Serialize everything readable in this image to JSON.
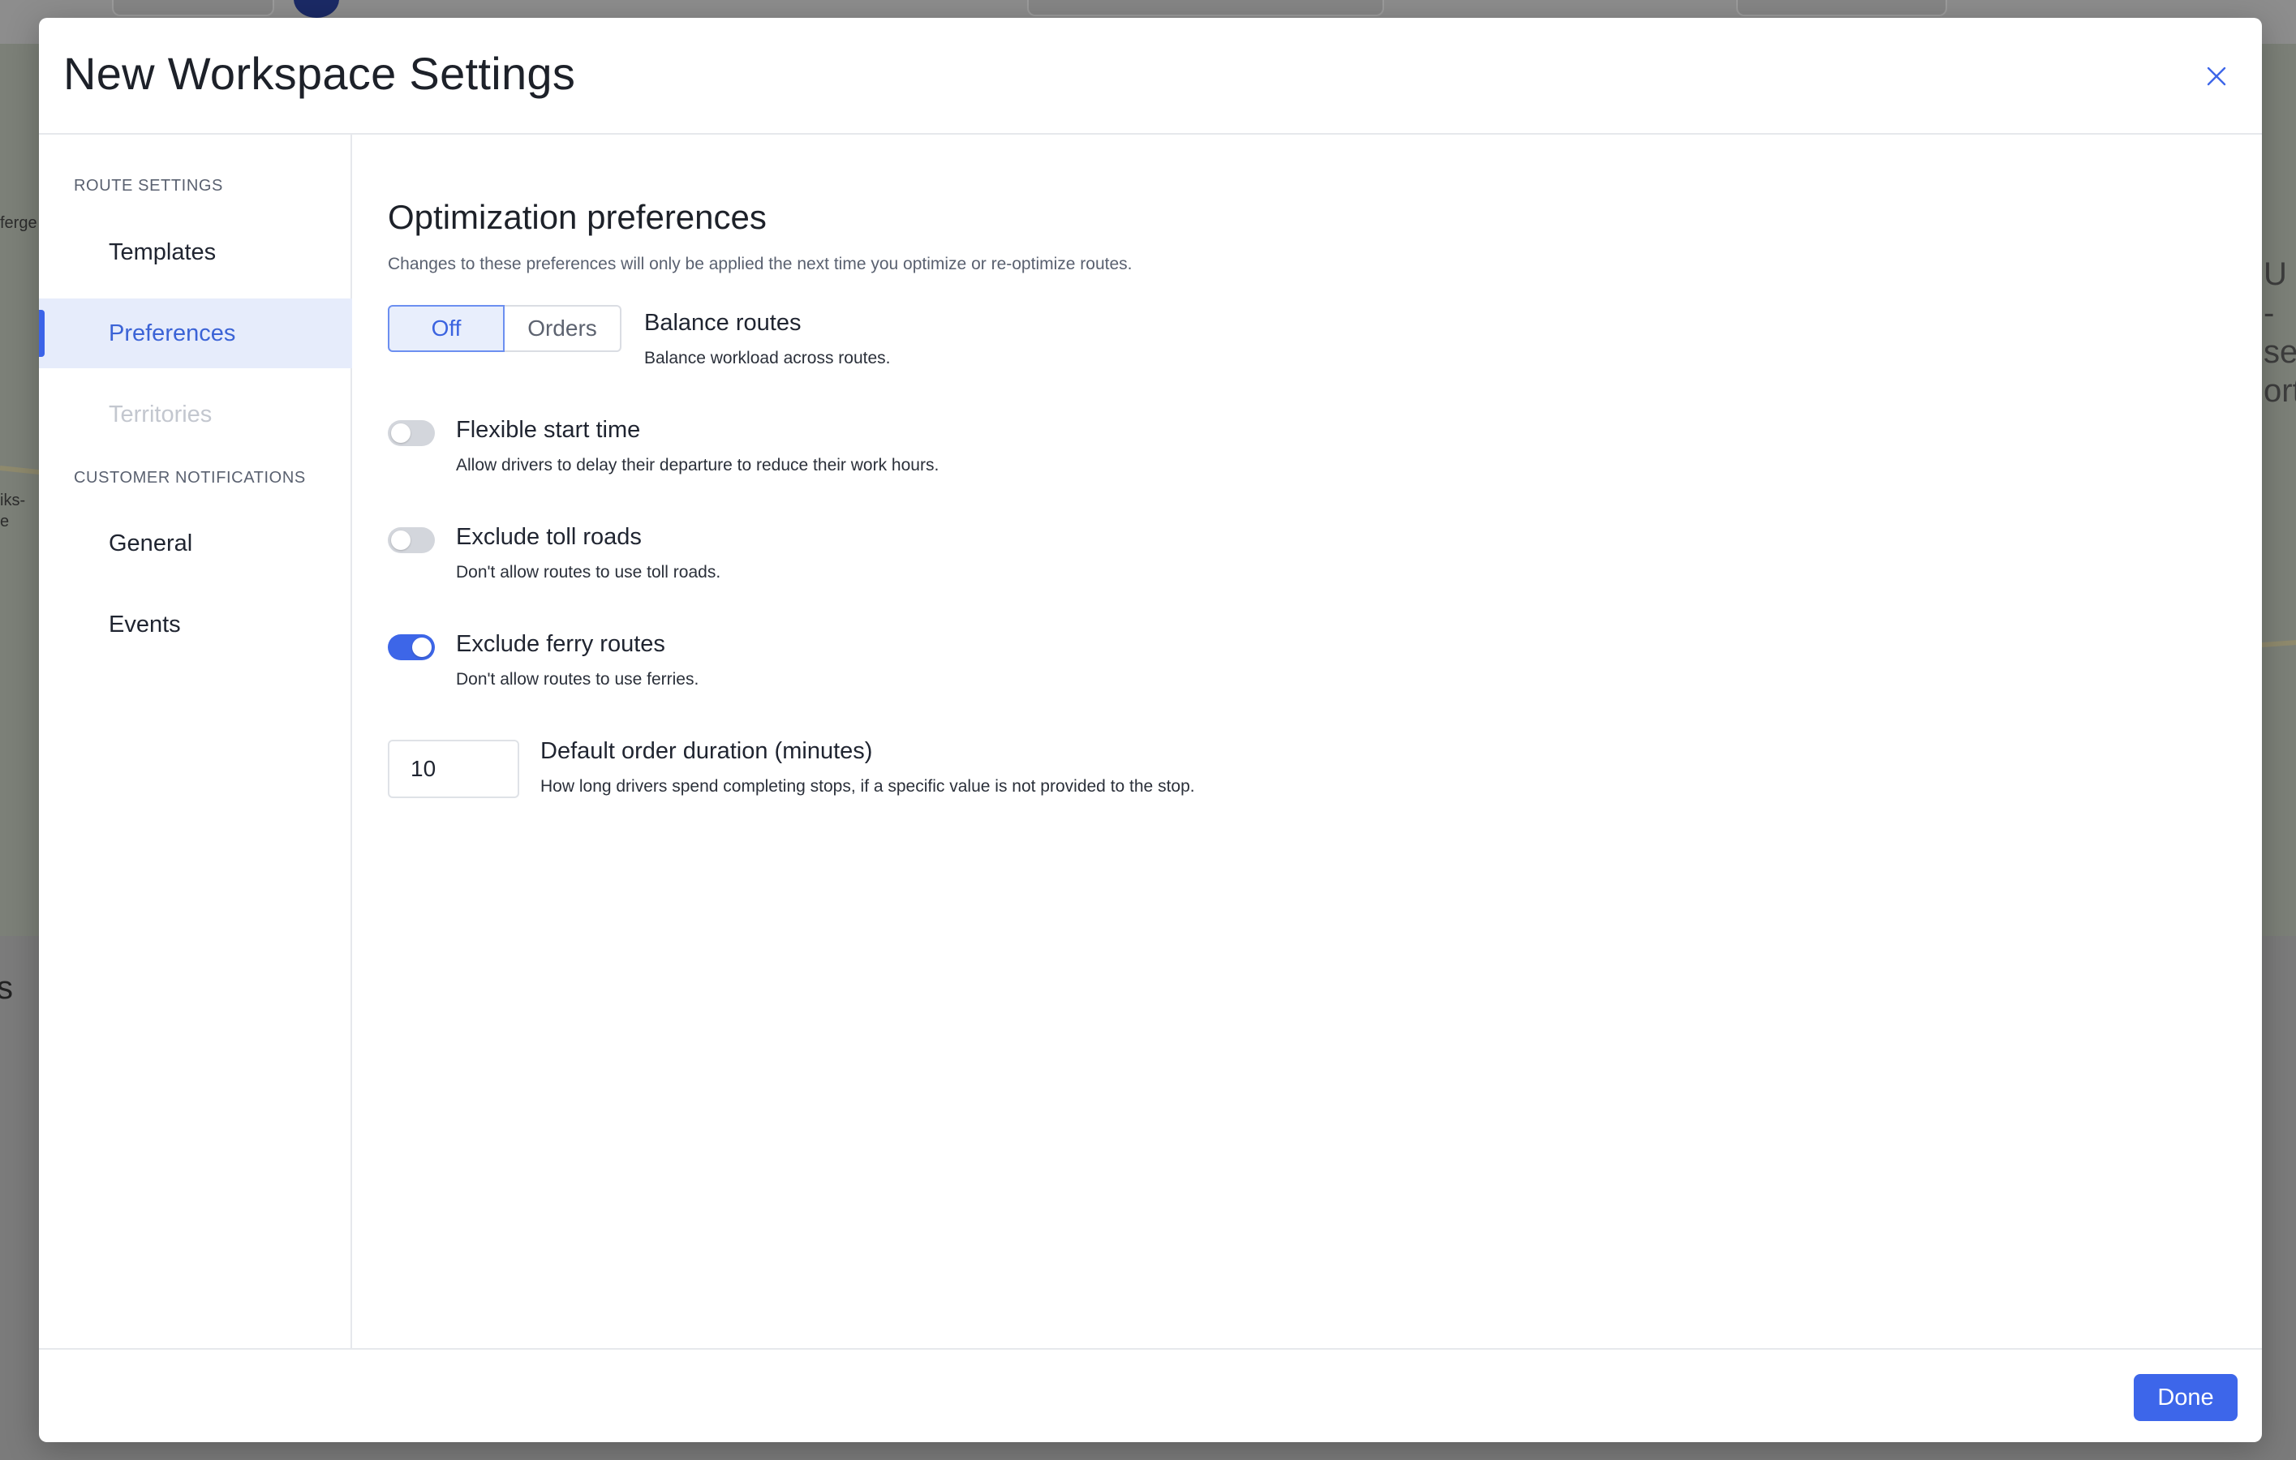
{
  "modal": {
    "title": "New Workspace Settings"
  },
  "sidebar": {
    "route_settings_label": "ROUTE SETTINGS",
    "customer_notifications_label": "CUSTOMER NOTIFICATIONS",
    "items": [
      {
        "label": "Templates",
        "state": "normal"
      },
      {
        "label": "Preferences",
        "state": "active"
      },
      {
        "label": "Territories",
        "state": "disabled"
      },
      {
        "label": "General",
        "state": "normal"
      },
      {
        "label": "Events",
        "state": "normal"
      }
    ]
  },
  "content": {
    "title": "Optimization preferences",
    "description": "Changes to these preferences will only be applied the next time you optimize or re-optimize routes.",
    "balance": {
      "options": [
        "Off",
        "Orders"
      ],
      "selected": "Off",
      "title": "Balance routes",
      "description": "Balance workload across routes."
    },
    "flexible_start": {
      "title": "Flexible start time",
      "description": "Allow drivers to delay their departure to reduce their work hours.",
      "enabled": false
    },
    "exclude_toll": {
      "title": "Exclude toll roads",
      "description": "Don't allow routes to use toll roads.",
      "enabled": false
    },
    "exclude_ferry": {
      "title": "Exclude ferry routes",
      "description": "Don't allow routes to use ferries.",
      "enabled": true
    },
    "default_duration": {
      "value": "10",
      "title": "Default order duration (minutes)",
      "description": "How long drivers spend completing stops, if a specific value is not provided to the stop."
    }
  },
  "footer": {
    "done_label": "Done"
  },
  "background": {
    "map_labels": [
      "ferge",
      "iks-",
      "e"
    ],
    "map_right_text": [
      "U -",
      "sel",
      "ort"
    ],
    "lower_text": "s"
  },
  "colors": {
    "accent": "#3d66ea",
    "active_bg": "#e6ecfb",
    "overlay": "#7d7f80"
  }
}
